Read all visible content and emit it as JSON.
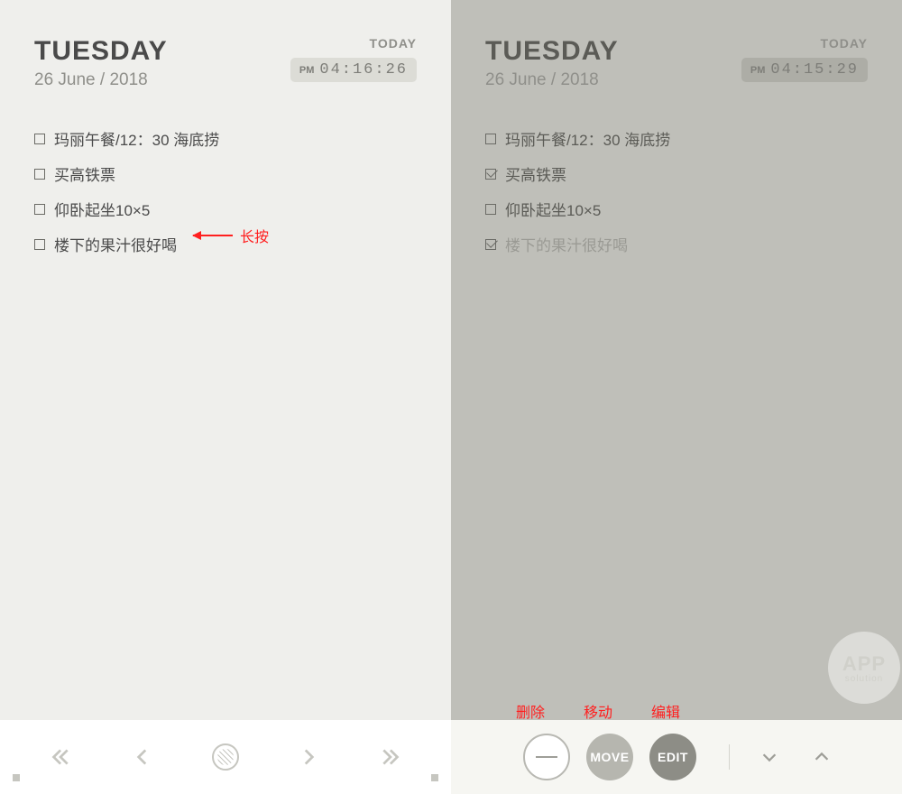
{
  "left": {
    "dayname": "TUESDAY",
    "date": "26 June / 2018",
    "today_label": "TODAY",
    "time_ampm": "PM",
    "time_digits": "04:16:26",
    "todos": [
      {
        "text": "玛丽午餐/12：30 海底捞",
        "checked": false
      },
      {
        "text": "买高铁票",
        "checked": false
      },
      {
        "text": "仰卧起坐10×5",
        "checked": false
      },
      {
        "text": "楼下的果汁很好喝",
        "checked": false
      }
    ],
    "annotation": "长按"
  },
  "right": {
    "dayname": "TUESDAY",
    "date": "26 June / 2018",
    "today_label": "TODAY",
    "time_ampm": "PM",
    "time_digits": "04:15:29",
    "todos": [
      {
        "text": "玛丽午餐/12：30 海底捞",
        "checked": false
      },
      {
        "text": "买高铁票",
        "checked": true
      },
      {
        "text": "仰卧起坐10×5",
        "checked": false
      },
      {
        "text": "楼下的果汁很好喝",
        "checked": true
      }
    ],
    "actions": {
      "delete_label": "删除",
      "move_label": "移动",
      "edit_label": "编辑",
      "move_btn": "MOVE",
      "edit_btn": "EDIT"
    }
  },
  "watermark": {
    "big": "APP",
    "small": "solution"
  }
}
